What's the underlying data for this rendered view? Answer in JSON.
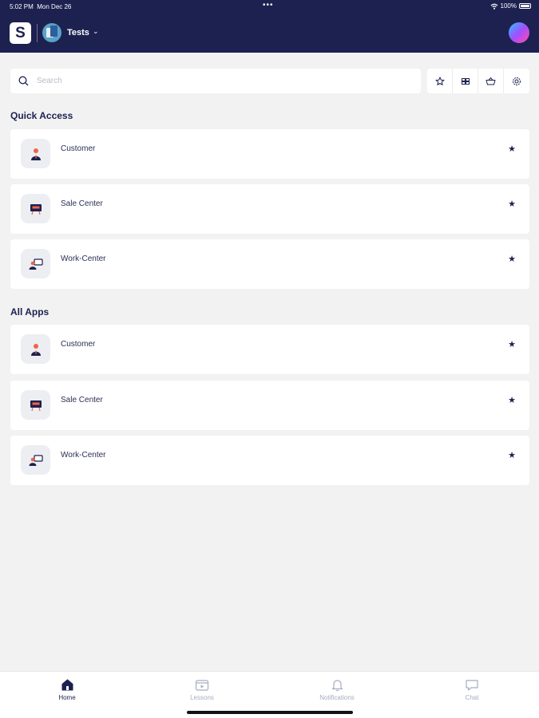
{
  "status_bar": {
    "time": "5:02 PM",
    "date": "Mon Dec 26",
    "dots": "•••",
    "battery": "100%"
  },
  "header": {
    "logo_letter": "S",
    "workspace_name": "Tests",
    "caret": "⌄"
  },
  "search": {
    "placeholder": "Search"
  },
  "toolbar": {
    "icons": [
      "star-outline-icon",
      "grid-icon",
      "basket-icon",
      "settings-icon"
    ]
  },
  "quick_access": {
    "title": "Quick Access",
    "items": [
      {
        "label": "Customer",
        "icon": "customer-icon"
      },
      {
        "label": "Sale Center",
        "icon": "sale-center-icon"
      },
      {
        "label": "Work-Center",
        "icon": "work-center-icon"
      }
    ]
  },
  "all_apps": {
    "title": "All Apps",
    "items": [
      {
        "label": "Customer",
        "icon": "customer-icon"
      },
      {
        "label": "Sale Center",
        "icon": "sale-center-icon"
      },
      {
        "label": "Work-Center",
        "icon": "work-center-icon"
      }
    ]
  },
  "star_glyph": "★",
  "bottom_nav": {
    "active": "Home",
    "items": [
      {
        "label": "Home",
        "icon": "home-icon"
      },
      {
        "label": "Lessons",
        "icon": "lessons-icon"
      },
      {
        "label": "Notifications",
        "icon": "bell-icon"
      },
      {
        "label": "Chat",
        "icon": "chat-icon"
      }
    ]
  },
  "colors": {
    "header_bg": "#1c2150",
    "page_bg": "#f2f2f3",
    "nav_active": "#1c2150",
    "nav_inactive": "#a7acc0"
  }
}
